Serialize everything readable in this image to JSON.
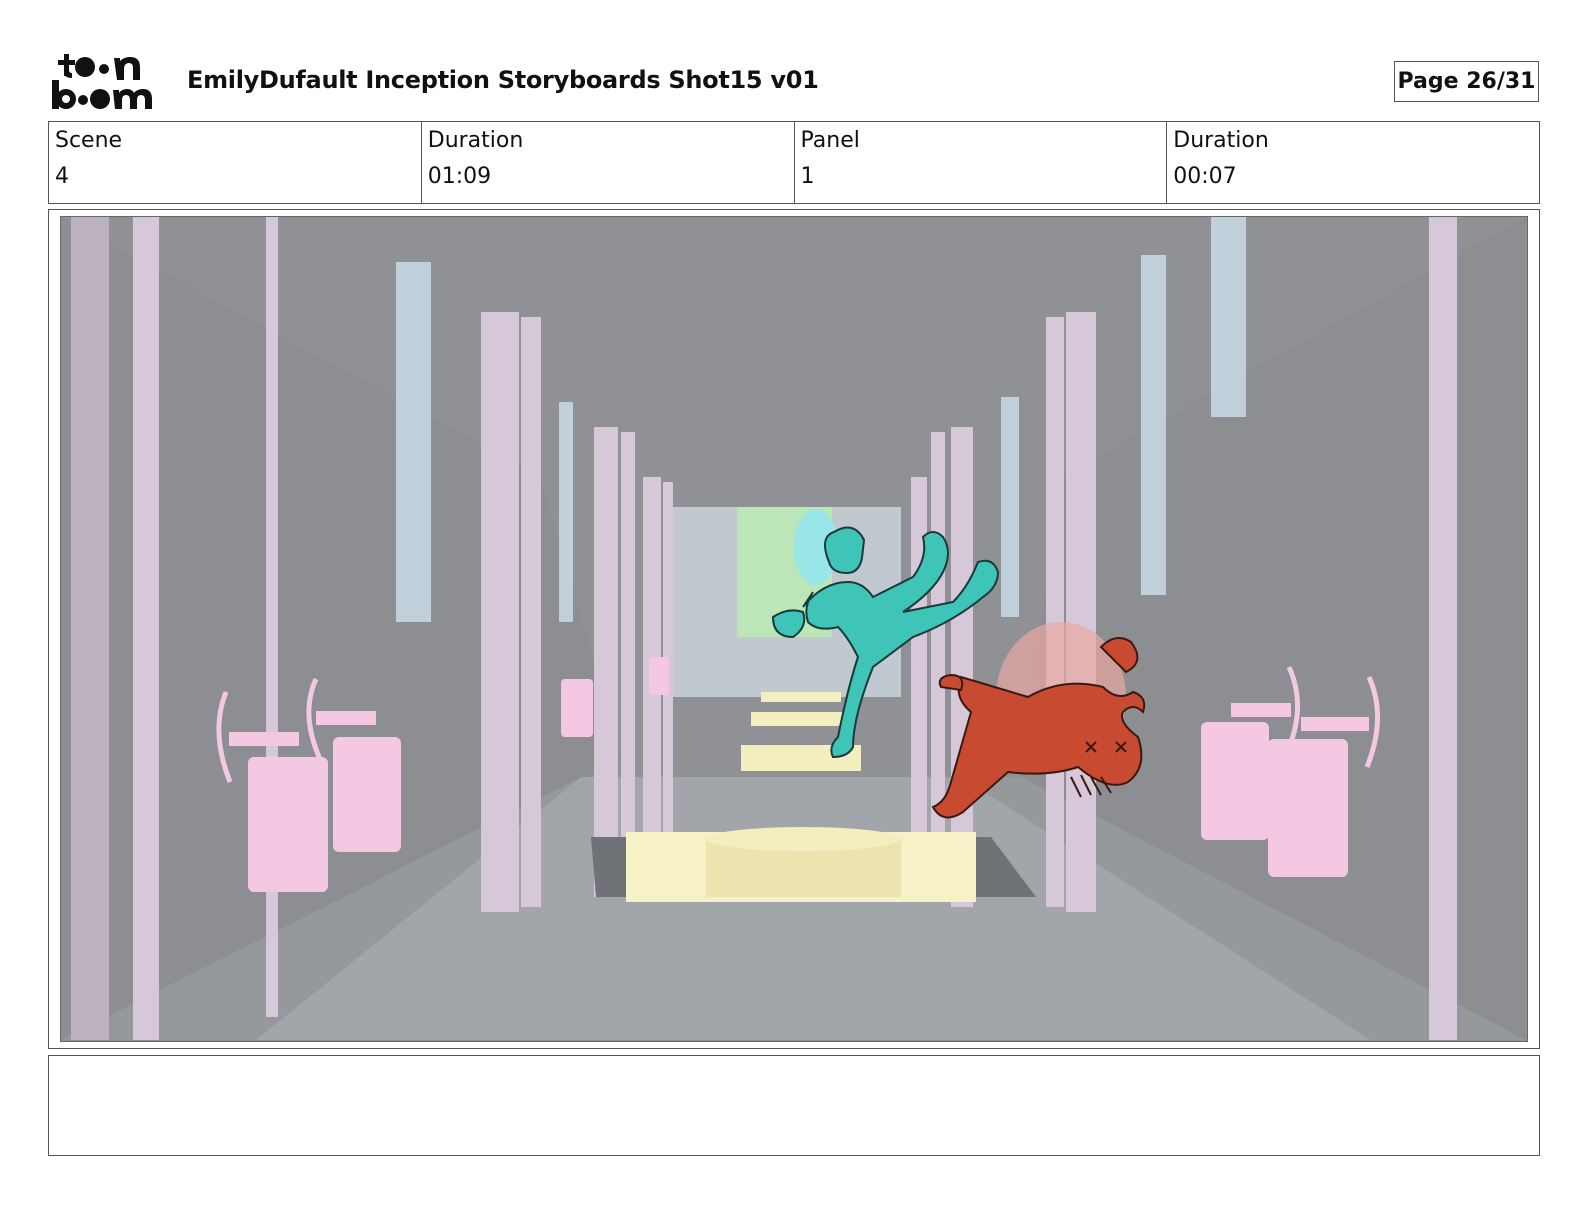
{
  "header": {
    "logo_text": "toon boom",
    "title": "EmilyDufault Inception Storyboards Shot15 v01",
    "page": "Page 26/31"
  },
  "info": {
    "scene_label": "Scene",
    "scene_value": "4",
    "scene_duration_label": "Duration",
    "scene_duration_value": "01:09",
    "panel_label": "Panel",
    "panel_value": "1",
    "panel_duration_label": "Duration",
    "panel_duration_value": "00:07"
  },
  "panel": {
    "illustration": "storyboard-drawing",
    "colors": {
      "background": "#8f9194",
      "floor": "#a2a6aa",
      "pillar": "#d8c8d8",
      "glass": "#c0d0da",
      "lamp": "#f4c8e2",
      "table": "#f6f1c6",
      "hero": "#3fc4b8",
      "enemy": "#c84a30",
      "doorway": "#bde6b8"
    }
  },
  "notes": {
    "text": ""
  }
}
